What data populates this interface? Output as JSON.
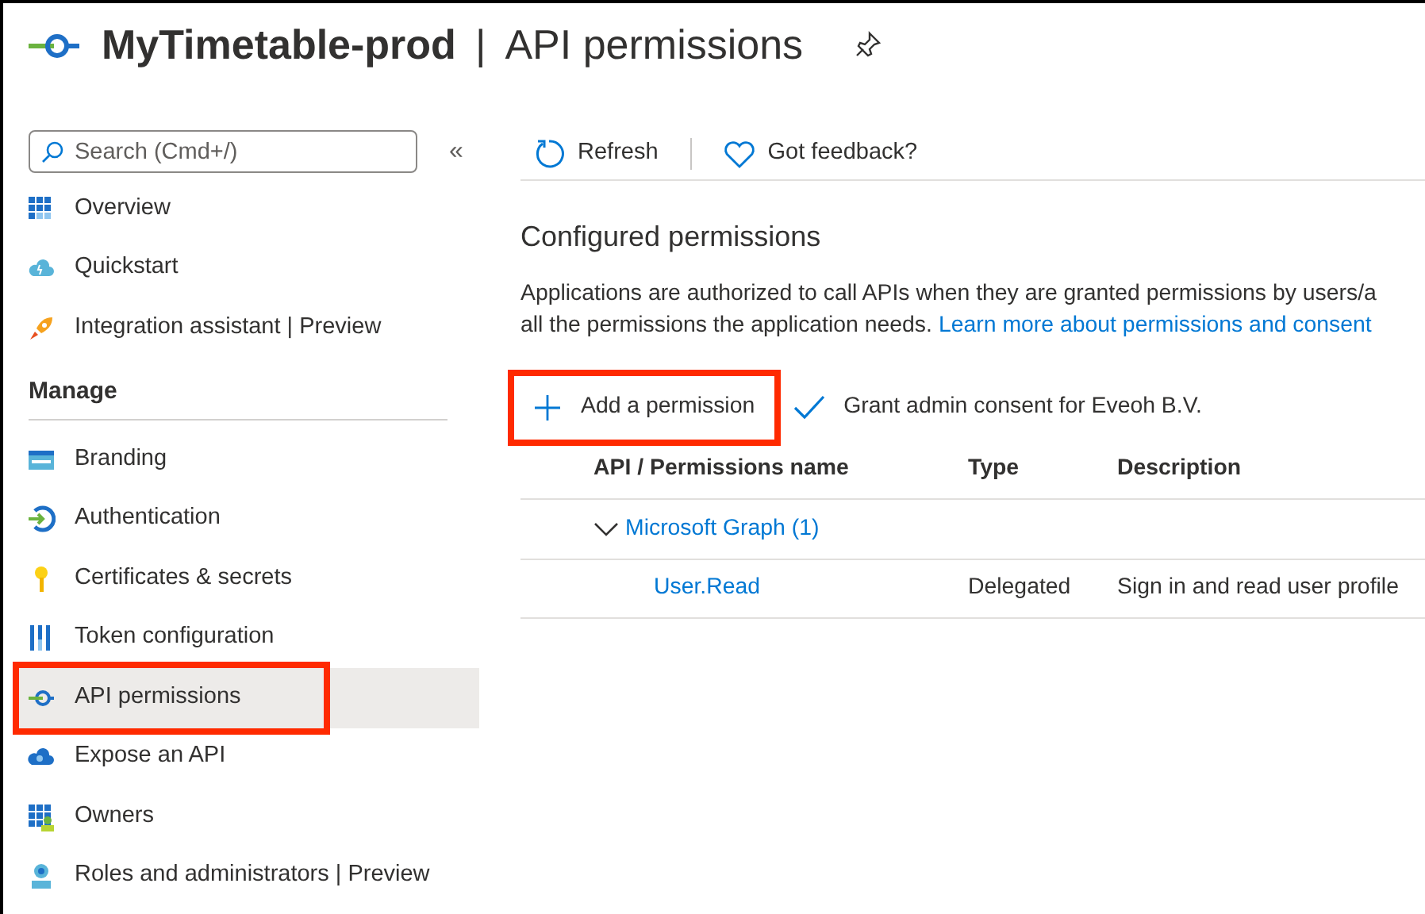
{
  "header": {
    "app_name": "MyTimetable-prod",
    "separator": "|",
    "page_title": "API permissions"
  },
  "sidebar": {
    "search": {
      "placeholder": "Search (Cmd+/)"
    },
    "collapse": "«",
    "items": [
      {
        "kind": "overview",
        "label": "Overview",
        "selected": false,
        "highlighted": false
      },
      {
        "kind": "quickstart",
        "label": "Quickstart",
        "selected": false,
        "highlighted": false
      },
      {
        "kind": "rocket",
        "label": "Integration assistant | Preview",
        "selected": false,
        "highlighted": false
      }
    ],
    "section": "Manage",
    "manage_items": [
      {
        "kind": "branding",
        "label": "Branding",
        "selected": false,
        "highlighted": false
      },
      {
        "kind": "auth",
        "label": "Authentication",
        "selected": false,
        "highlighted": false
      },
      {
        "kind": "key",
        "label": "Certificates & secrets",
        "selected": false,
        "highlighted": false
      },
      {
        "kind": "token",
        "label": "Token configuration",
        "selected": false,
        "highlighted": false
      },
      {
        "kind": "api",
        "label": "API permissions",
        "selected": true,
        "highlighted": true
      },
      {
        "kind": "expose",
        "label": "Expose an API",
        "selected": false,
        "highlighted": false
      },
      {
        "kind": "owners",
        "label": "Owners",
        "selected": false,
        "highlighted": false
      },
      {
        "kind": "roles",
        "label": "Roles and administrators | Preview",
        "selected": false,
        "highlighted": false
      }
    ]
  },
  "toolbar": [
    {
      "kind": "refresh",
      "label": "Refresh"
    },
    {
      "kind": "feedback",
      "label": "Got feedback?"
    }
  ],
  "section_title": "Configured permissions",
  "description_lines": [
    "Applications are authorized to call APIs when they are granted permissions by users/a",
    "all the permissions the application needs."
  ],
  "learn_more": "Learn more about permissions and consent",
  "actions": [
    {
      "kind": "add",
      "label": "Add a permission",
      "highlighted": true
    },
    {
      "kind": "grant",
      "label": "Grant admin consent for Eveoh B.V.",
      "highlighted": false
    }
  ],
  "table": {
    "columns": [
      "API / Permissions name",
      "Type",
      "Description"
    ],
    "groups": [
      {
        "name": "Microsoft Graph (1)",
        "expanded": true,
        "rows": [
          {
            "name": "User.Read",
            "type": "Delegated",
            "description": "Sign in and read user profile"
          }
        ]
      }
    ]
  }
}
